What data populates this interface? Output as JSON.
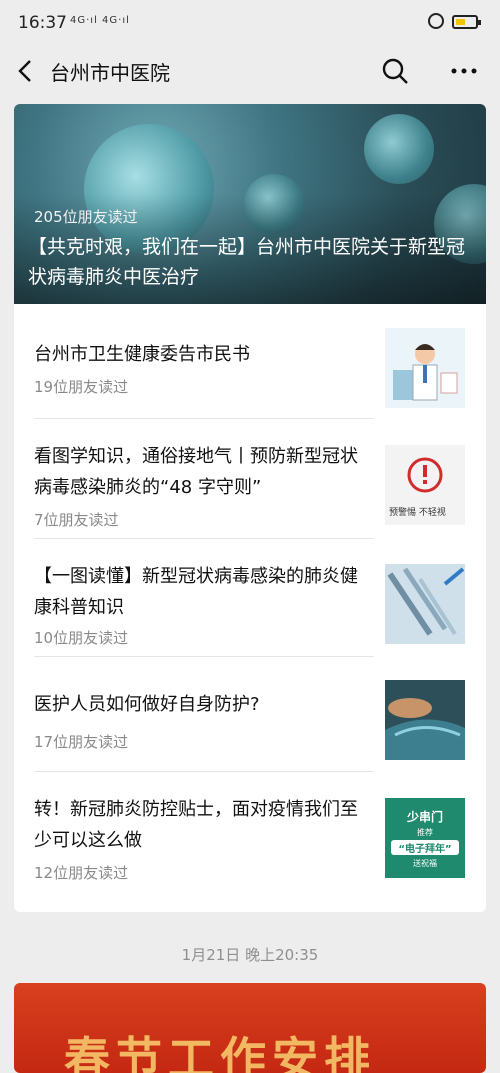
{
  "status": {
    "time": "16:37",
    "signal": "4G·ıl 4G·ıl"
  },
  "nav": {
    "title": "台州市中医院"
  },
  "featured": {
    "reads": "205位朋友读过",
    "headline": "【共克时艰，我们在一起】台州市中医院关于新型冠状病毒肺炎中医治疗"
  },
  "articles": [
    {
      "title": "台州市卫生健康委告市民书",
      "reads": "19位朋友读过"
    },
    {
      "title": "看图学知识，通俗接地气丨预防新型冠状病毒感染肺炎的“48 字守则”",
      "reads": "7位朋友读过",
      "thumb_text": "预警惕  不轻视"
    },
    {
      "title": "【一图读懂】新型冠状病毒感染的肺炎健康科普知识",
      "reads": "10位朋友读过"
    },
    {
      "title": "医护人员如何做好自身防护?",
      "reads": "17位朋友读过"
    },
    {
      "title": "转！新冠肺炎防控贴士，面对疫情我们至少可以这么做",
      "reads": "12位朋友读过",
      "thumb_line1": "少串门",
      "thumb_line2": "推荐",
      "thumb_line3": "“电子拜年”",
      "thumb_line4": "送祝福"
    }
  ],
  "date": "1月21日 晚上20:35",
  "next_banner": "春节工作安排",
  "colors": {
    "background": "#ededed",
    "card": "#ffffff",
    "muted": "#8a8a8a",
    "battery": "#f5c400"
  }
}
